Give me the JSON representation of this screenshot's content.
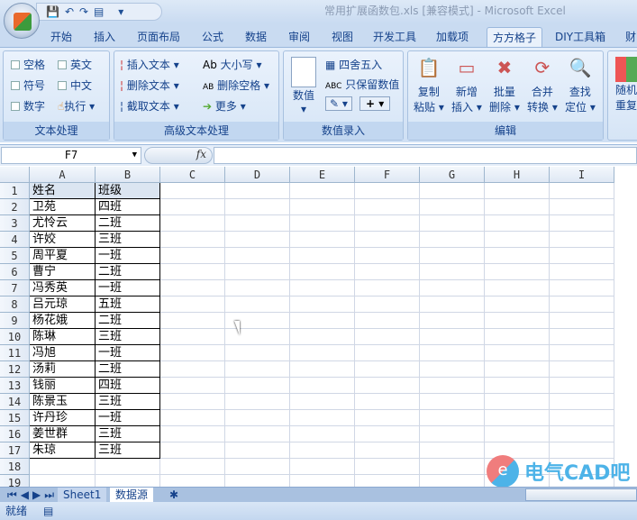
{
  "window": {
    "title": "常用扩展函数包.xls  [兼容模式] - Microsoft Excel",
    "qat": "💾↶↷▤ ▾"
  },
  "tabs": [
    "开始",
    "插入",
    "页面布局",
    "公式",
    "数据",
    "审阅",
    "视图",
    "开发工具",
    "加载项",
    "方方格子",
    "DIY工具箱",
    "财"
  ],
  "ribbon": {
    "text_group": {
      "label": "文本处理",
      "items": [
        "空格",
        "英文",
        "符号",
        "中文",
        "数字",
        "执行"
      ]
    },
    "adv_group": {
      "label": "高级文本处理",
      "items": [
        "插入文本",
        "删除文本",
        "截取文本",
        "大小写",
        "删除空格",
        "更多"
      ]
    },
    "num_group": {
      "label": "数值录入",
      "value_btn": "数值",
      "round": "四舍五入",
      "keep_value": "只保留数值",
      "plus": "+"
    },
    "edit_group": {
      "label": "编辑",
      "buttons": [
        {
          "l1": "复制",
          "l2": "粘贴"
        },
        {
          "l1": "新增",
          "l2": "插入"
        },
        {
          "l1": "批量",
          "l2": "删除"
        },
        {
          "l1": "合并",
          "l2": "转换"
        },
        {
          "l1": "查找",
          "l2": "定位"
        }
      ]
    },
    "extra_group": {
      "l1": "随机",
      "l2": "重复"
    }
  },
  "formula_bar": {
    "name_box": "F7",
    "fx": "fx",
    "value": ""
  },
  "columns": [
    "A",
    "B",
    "C",
    "D",
    "E",
    "F",
    "G",
    "H",
    "I"
  ],
  "rows": [
    [
      "姓名",
      "班级"
    ],
    [
      "卫苑",
      "四班"
    ],
    [
      "尤怜云",
      "二班"
    ],
    [
      "许姣",
      "三班"
    ],
    [
      "周平夏",
      "一班"
    ],
    [
      "曹宁",
      "二班"
    ],
    [
      "冯秀英",
      "一班"
    ],
    [
      "吕元琼",
      "五班"
    ],
    [
      "杨花娥",
      "二班"
    ],
    [
      "陈琳",
      "三班"
    ],
    [
      "冯旭",
      "一班"
    ],
    [
      "汤莉",
      "二班"
    ],
    [
      "钱丽",
      "四班"
    ],
    [
      "陈景玉",
      "三班"
    ],
    [
      "许丹珍",
      "一班"
    ],
    [
      "姜世群",
      "三班"
    ],
    [
      "朱琼",
      "三班"
    ],
    [
      "",
      ""
    ],
    [
      "",
      ""
    ]
  ],
  "sheets": [
    "Sheet1",
    "数据源"
  ],
  "active_sheet": "数据源",
  "status": {
    "text": "就绪"
  },
  "watermark": {
    "logo": "eA",
    "text": "电气CAD吧"
  }
}
